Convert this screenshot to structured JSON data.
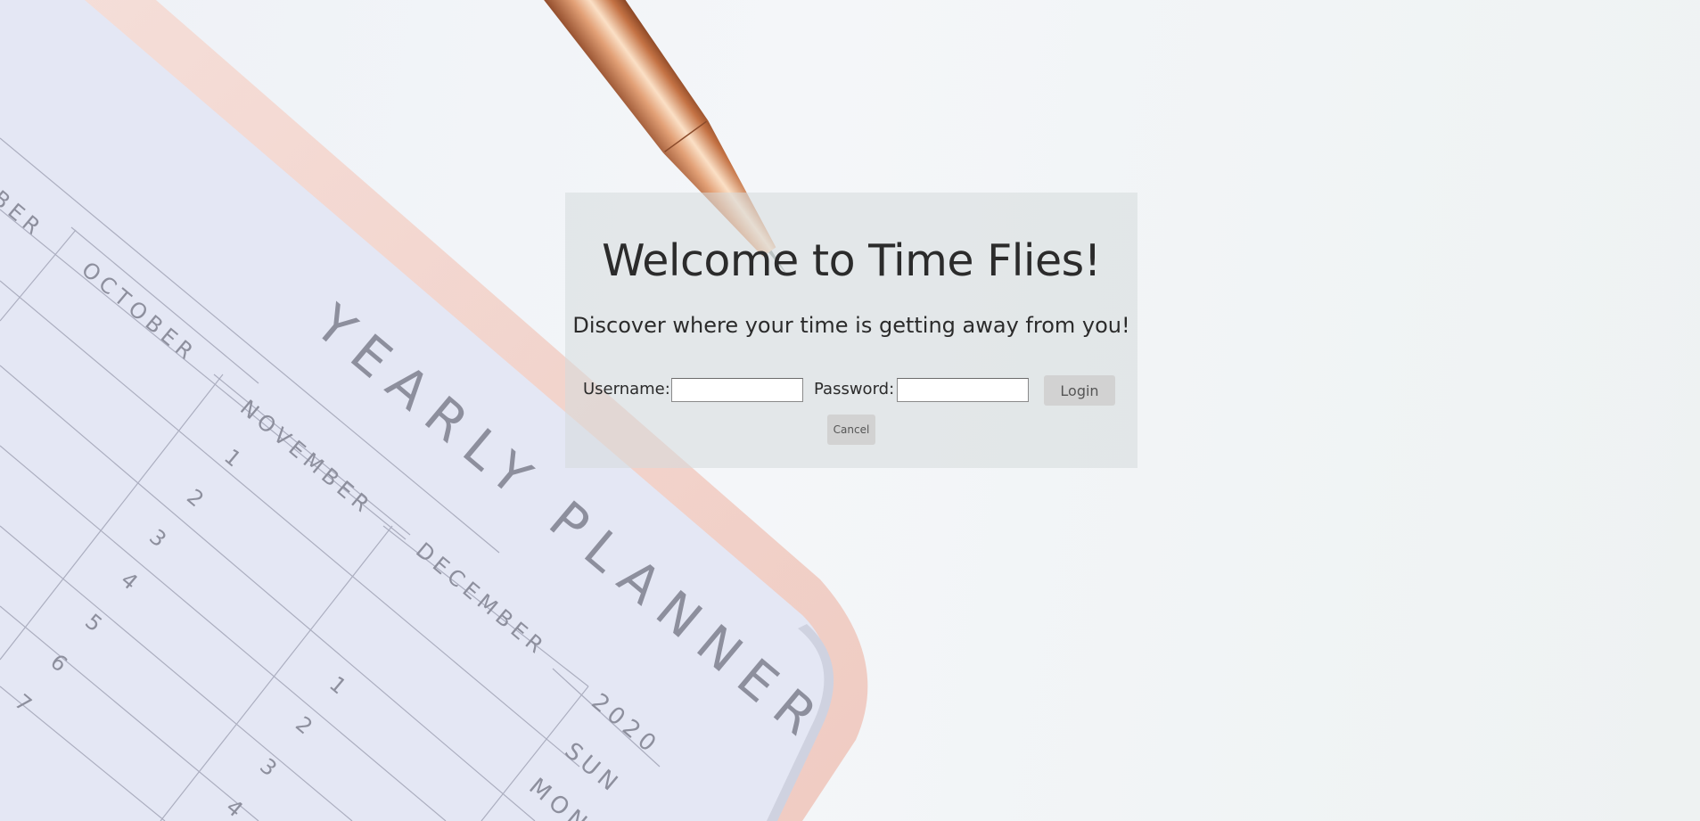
{
  "login": {
    "title": "Welcome to Time Flies!",
    "subtitle": "Discover where your time is getting away from you!",
    "username_label": "Username:",
    "username_value": "",
    "password_label": "Password:",
    "password_value": "",
    "login_label": "Login",
    "cancel_label": "Cancel"
  },
  "background": {
    "planner_title": "YEARLY PLANNER",
    "months": [
      "BER",
      "OCTOBER",
      "NOVEMBER",
      "DECEMBER"
    ],
    "year": "2020",
    "days": [
      "SUN",
      "MON"
    ],
    "col_a_numbers": [
      "1",
      "2",
      "3",
      "4",
      "5",
      "6",
      "7"
    ],
    "col_b_numbers": [
      "1",
      "2",
      "3",
      "4"
    ],
    "colors": {
      "page": "#e4e7f4",
      "cover": "#f0c8bc",
      "pen": "#c8784a",
      "panel": "#d6dadd",
      "button": "#d2d2d2"
    }
  }
}
